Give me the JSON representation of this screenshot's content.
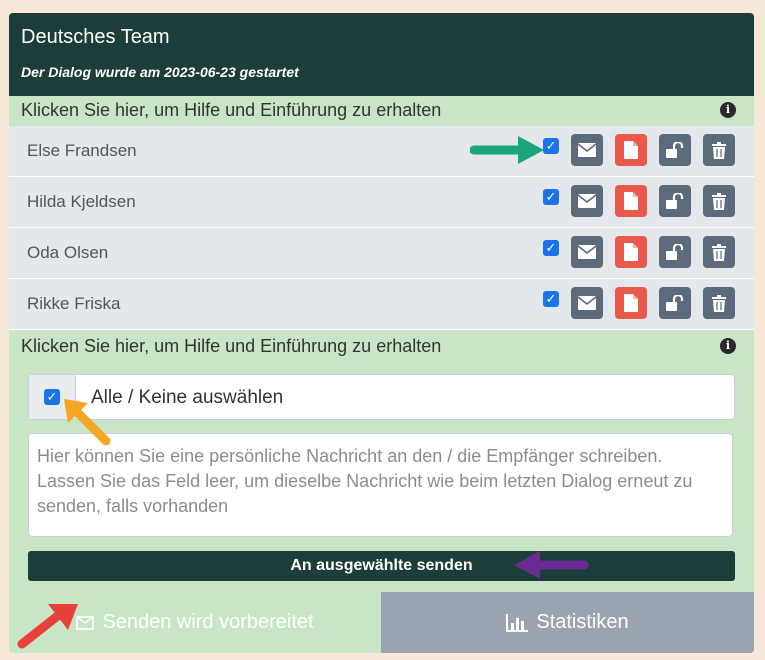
{
  "header": {
    "title": "Deutsches Team",
    "subtitle": "Der Dialog wurde am 2023-06-23 gestartet"
  },
  "help_text": "Klicken Sie hier, um Hilfe und Einführung zu erhalten",
  "members": [
    {
      "name": "Else Frandsen",
      "selected": true
    },
    {
      "name": "Hilda Kjeldsen",
      "selected": true
    },
    {
      "name": "Oda Olsen",
      "selected": true
    },
    {
      "name": "Rikke Friska",
      "selected": true
    }
  ],
  "select_all": {
    "label": "Alle / Keine auswählen",
    "checked": true
  },
  "message": {
    "value": "",
    "placeholder": "Hier können Sie eine persönliche Nachricht an den / die Empfänger schreiben. Lassen Sie das Feld leer, um dieselbe Nachricht wie beim letzten Dialog erneut zu senden, falls vorhanden"
  },
  "send_button": "An ausgewählte senden",
  "tabs": {
    "sending": "Senden wird vorbereitet",
    "statistics": "Statistiken"
  },
  "icons": [
    "info-icon",
    "envelope-icon",
    "document-icon",
    "unlock-icon",
    "trash-icon",
    "chart-icon"
  ],
  "colors": {
    "header_bg": "#1c3d3a",
    "panel_bg": "#c8e6c5",
    "row_bg": "#e4e7eb",
    "button_gray": "#5b6b7c",
    "button_red": "#e95a4a",
    "checkbox_blue": "#1a73e8",
    "stats_tab_bg": "#9aa3b0",
    "arrow_green": "#1aa67a",
    "arrow_orange": "#f5a623",
    "arrow_purple": "#6b2c91",
    "arrow_red": "#e8403a"
  }
}
